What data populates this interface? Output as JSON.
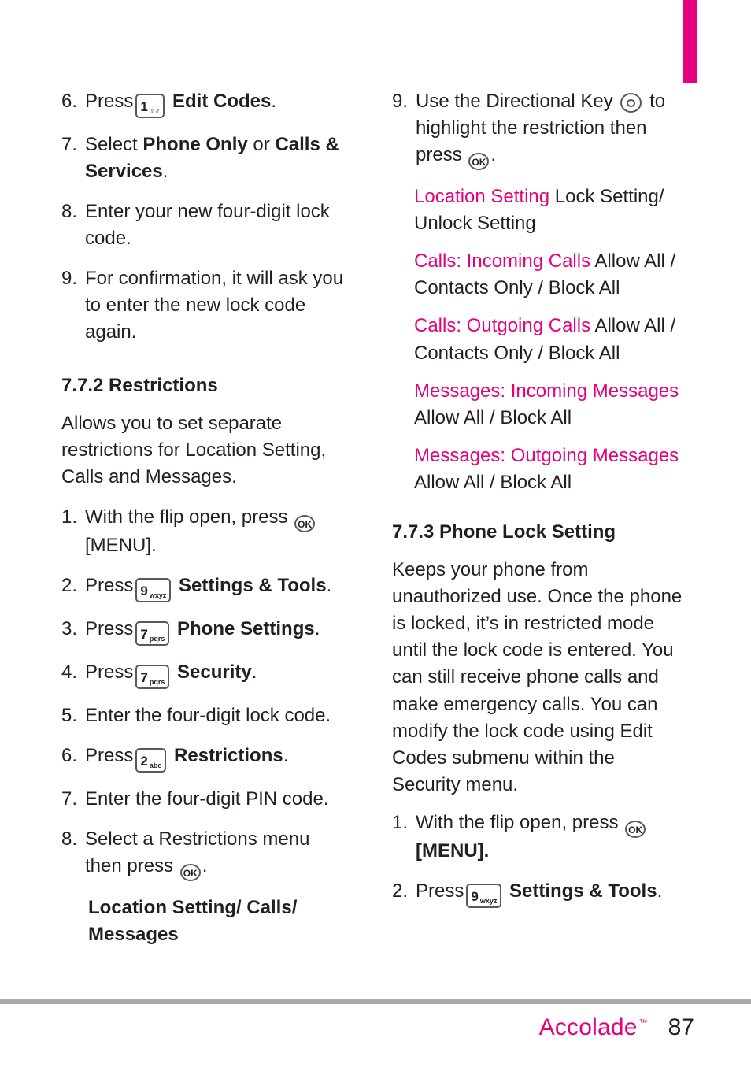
{
  "page": {
    "number": "87",
    "brand": "Accolade",
    "trademark": "™"
  },
  "left_column": {
    "items": [
      {
        "num": "6.",
        "pre": "Press",
        "key": {
          "digit": "1",
          "letters": "♀♂"
        },
        "bold": "Edit Codes",
        "post": "."
      },
      {
        "num": "7.",
        "pre": "Select",
        "bold": "Phone Only",
        "mid": " or ",
        "bold2": "Calls & Services",
        "post": "."
      },
      {
        "num": "8.",
        "text": "Enter your new four-digit lock code."
      },
      {
        "num": "9.",
        "text": "For confirmation, it will ask you to enter the new lock code again."
      }
    ],
    "heading": "7.7.2 Restrictions",
    "intro": "Allows you to set separate restrictions for Location Setting, Calls and Messages.",
    "steps": [
      {
        "num": "1.",
        "pre": "With the flip open, press",
        "okkey": "OK",
        "post": "[MENU]."
      },
      {
        "num": "2.",
        "pre": "Press",
        "key": {
          "digit": "9",
          "letters": "wxyz"
        },
        "bold": "Settings & Tools",
        "post": "."
      },
      {
        "num": "3.",
        "pre": "Press",
        "key": {
          "digit": "7",
          "letters": "pqrs"
        },
        "bold": "Phone Settings",
        "post": "."
      },
      {
        "num": "4.",
        "pre": "Press",
        "key": {
          "digit": "7",
          "letters": "pqrs"
        },
        "bold": "Security",
        "post": "."
      },
      {
        "num": "5.",
        "text": "Enter the four-digit lock code."
      },
      {
        "num": "6.",
        "pre": "Press",
        "key": {
          "digit": "2",
          "letters": "abc"
        },
        "bold": "Restrictions",
        "post": "."
      },
      {
        "num": "7.",
        "text": "Enter the four-digit PIN code."
      },
      {
        "num": "8.",
        "pre": "Select a Restrictions menu then press",
        "okkey": "OK",
        "post": "."
      }
    ],
    "submenu": "Location Setting/ Calls/ Messages"
  },
  "right_column": {
    "step9": {
      "num": "9.",
      "pre": "Use the Directional Key",
      "mid": "to highlight the restriction then press",
      "okkey": "OK",
      "post": "."
    },
    "options": [
      {
        "key": "Location Setting",
        "value": "Lock Setting/ Unlock Setting"
      },
      {
        "key": "Calls: Incoming Calls",
        "value": "Allow All / Contacts Only / Block All"
      },
      {
        "key": "Calls: Outgoing Calls",
        "value": "Allow All / Contacts Only / Block All"
      },
      {
        "key": "Messages: Incoming Messages",
        "value": "Allow All / Block All"
      },
      {
        "key": "Messages: Outgoing Messages",
        "value": "Allow All / Block All"
      }
    ],
    "heading": "7.7.3 Phone Lock Setting",
    "intro": "Keeps your phone from unauthorized use. Once the phone is locked, it’s in restricted mode until the lock code is entered. You can still receive phone calls and make emergency calls. You can modify the lock code using Edit Codes submenu within the Security menu.",
    "steps": [
      {
        "num": "1.",
        "pre": "With the flip open, press",
        "okkey": "OK",
        "post": "[MENU]."
      },
      {
        "num": "2.",
        "pre": "Press",
        "key": {
          "digit": "9",
          "letters": "wxyz"
        },
        "bold": "Settings & Tools",
        "post": "."
      }
    ]
  },
  "colors": {
    "accent": "#e6007e",
    "text": "#231f20",
    "rule": "#a7a9ac"
  }
}
